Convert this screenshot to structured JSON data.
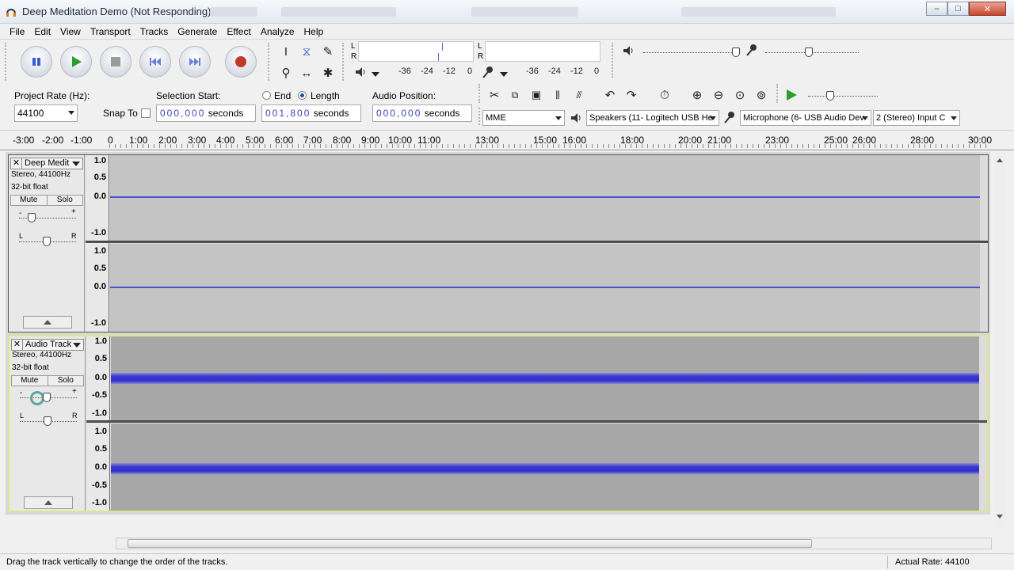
{
  "window": {
    "title": "Deep Meditation Demo (Not Responding)",
    "controls": {
      "minimize": "–",
      "maximize": "□",
      "close": "✕"
    }
  },
  "menu": [
    "File",
    "Edit",
    "View",
    "Transport",
    "Tracks",
    "Generate",
    "Effect",
    "Analyze",
    "Help"
  ],
  "meters": {
    "play_scale": [
      "-36",
      "-24",
      "-12",
      "0"
    ],
    "rec_scale": [
      "-36",
      "-24",
      "-12",
      "0"
    ],
    "channel_l": "L",
    "channel_r": "R"
  },
  "selection_bar": {
    "project_rate_label": "Project Rate (Hz):",
    "project_rate_value": "44100",
    "snap_label": "Snap To",
    "selection_start_label": "Selection Start:",
    "end_label": "End",
    "length_label": "Length",
    "start_digits": "000,000",
    "start_unit": "seconds",
    "length_digits": "001,800",
    "length_unit": "seconds",
    "audio_position_label": "Audio Position:",
    "audio_pos_digits": "000,000",
    "audio_pos_unit": "seconds"
  },
  "devices": {
    "host": "MME",
    "output": "Speakers (11- Logitech USB He",
    "input": "Microphone (6- USB Audio Dev",
    "channels": "2 (Stereo) Input C"
  },
  "ruler": {
    "ticks": [
      "-3:00",
      "-2:00",
      "-1:00",
      "0",
      "1:00",
      "2:00",
      "3:00",
      "4:00",
      "5:00",
      "6:00",
      "7:00",
      "8:00",
      "9:00",
      "10:00",
      "11:00",
      "13:00",
      "15:00",
      "16:00",
      "18:00",
      "20:00",
      "21:00",
      "23:00",
      "25:00",
      "26:00",
      "28:00",
      "30:00"
    ]
  },
  "tracks": [
    {
      "name": "Deep Medit",
      "format": "Stereo, 44100Hz",
      "depth": "32-bit float",
      "mute": "Mute",
      "solo": "Solo",
      "gain_minus": "-",
      "gain_plus": "+",
      "pan_l": "L",
      "pan_r": "R",
      "scale_top": [
        "1.0",
        "0.5",
        "0.0",
        "-1.0"
      ],
      "scale_bottom": [
        "1.0",
        "0.5",
        "0.0",
        "-1.0"
      ]
    },
    {
      "name": "Audio Track",
      "format": "Stereo, 44100Hz",
      "depth": "32-bit float",
      "mute": "Mute",
      "solo": "Solo",
      "gain_minus": "-",
      "gain_plus": "+",
      "pan_l": "L",
      "pan_r": "R",
      "scale_top": [
        "1.0",
        "0.5",
        "0.0",
        "-0.5",
        "-1.0"
      ],
      "scale_bottom": [
        "1.0",
        "0.5",
        "0.0",
        "-0.5",
        "-1.0"
      ]
    }
  ],
  "status": {
    "message": "Drag the track vertically to change the order of the tracks.",
    "rate": "Actual Rate: 44100"
  },
  "colors": {
    "waveform": "#3b3bd0",
    "selected_track_border": "#e1e48a",
    "record": "#c0392b",
    "play": "#2e9c2e"
  }
}
